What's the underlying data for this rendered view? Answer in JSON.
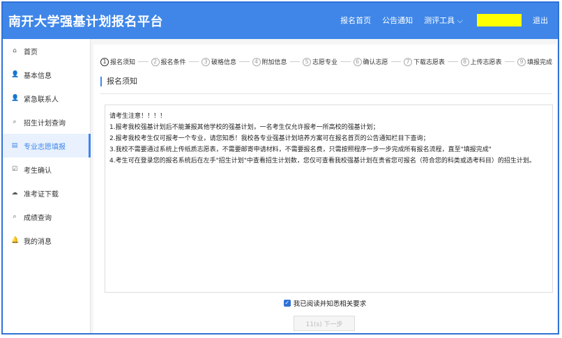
{
  "header": {
    "title": "南开大学强基计划报名平台",
    "nav": [
      "报名首页",
      "公告通知",
      "测评工具 ⌵"
    ],
    "logout": "退出"
  },
  "sidebar": {
    "items": [
      {
        "label": "首页",
        "icon": "home-icon",
        "glyph": "⌂"
      },
      {
        "label": "基本信息",
        "icon": "user-icon",
        "glyph": "👤"
      },
      {
        "label": "紧急联系人",
        "icon": "user-icon",
        "glyph": "👤"
      },
      {
        "label": "招生计划查询",
        "icon": "search-icon",
        "glyph": "⌕"
      },
      {
        "label": "专业志愿填报",
        "icon": "form-icon",
        "glyph": "▤",
        "active": true
      },
      {
        "label": "考生确认",
        "icon": "check-square-icon",
        "glyph": "☑"
      },
      {
        "label": "准考证下载",
        "icon": "cloud-download-icon",
        "glyph": "☁"
      },
      {
        "label": "成绩查询",
        "icon": "search-icon",
        "glyph": "⌕"
      },
      {
        "label": "我的消息",
        "icon": "bell-icon",
        "glyph": "🔔"
      }
    ]
  },
  "steps": [
    {
      "num": "1",
      "label": "报名须知"
    },
    {
      "num": "2",
      "label": "报名条件"
    },
    {
      "num": "3",
      "label": "破格信息"
    },
    {
      "num": "4",
      "label": "附加信息"
    },
    {
      "num": "5",
      "label": "志愿专业"
    },
    {
      "num": "6",
      "label": "确认志愿"
    },
    {
      "num": "7",
      "label": "下载志愿表"
    },
    {
      "num": "8",
      "label": "上传志愿表"
    },
    {
      "num": "9",
      "label": "填报完成"
    }
  ],
  "section_title": "报名须知",
  "notice": {
    "heading": "请考生注意！！！！",
    "lines": [
      "1.报考我校强基计划后不能兼报其他学校的强基计划，一名考生仅允许报考一所高校的强基计划；",
      "2.报考我校考生仅可报考一个专业，请您知悉！我校各专业强基计划培养方案可在报名首页的公告通知栏目下查询；",
      "3.我校不需要通过系统上传纸质志愿表，不需要邮寄申请材料，不需要报名费，只需按照程序一步一步完成所有报名流程，直至\"填报完成\"",
      "4.考生可在登录您的报名系统后在左手\"招生计划\"中查看招生计划数，您仅可查看我校强基计划在贵省您可报名（符合您的科类或选考科目）的招生计划。"
    ]
  },
  "agree_label": "我已阅读并知悉相关要求",
  "next_button": "11(s) 下一步"
}
